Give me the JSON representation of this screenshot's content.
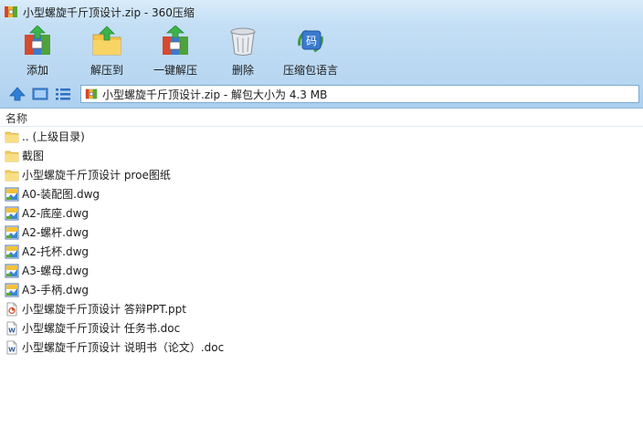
{
  "window": {
    "title": "小型螺旋千斤顶设计.zip - 360压缩"
  },
  "toolbar": {
    "items": [
      {
        "label": "添加",
        "icon": "add-archive-icon"
      },
      {
        "label": "解压到",
        "icon": "extract-to-icon"
      },
      {
        "label": "一键解压",
        "icon": "one-click-extract-icon"
      },
      {
        "label": "删除",
        "icon": "trash-bin-icon"
      },
      {
        "label": "压缩包语言",
        "icon": "archive-language-icon"
      }
    ]
  },
  "address": {
    "path": "小型螺旋千斤顶设计.zip - 解包大小为 4.3 MB"
  },
  "list": {
    "column_name": "名称",
    "rows": [
      {
        "name": ".. (上级目录)",
        "type": "folder"
      },
      {
        "name": "截图",
        "type": "folder"
      },
      {
        "name": "小型螺旋千斤顶设计 proe图纸",
        "type": "folder"
      },
      {
        "name": "A0-装配图.dwg",
        "type": "dwg"
      },
      {
        "name": "A2-底座.dwg",
        "type": "dwg"
      },
      {
        "name": "A2-螺杆.dwg",
        "type": "dwg"
      },
      {
        "name": "A2-托杯.dwg",
        "type": "dwg"
      },
      {
        "name": "A3-螺母.dwg",
        "type": "dwg"
      },
      {
        "name": "A3-手柄.dwg",
        "type": "dwg"
      },
      {
        "name": "小型螺旋千斤顶设计 答辩PPT.ppt",
        "type": "ppt"
      },
      {
        "name": "小型螺旋千斤顶设计 任务书.doc",
        "type": "doc"
      },
      {
        "name": "小型螺旋千斤顶设计 说明书（论文）.doc",
        "type": "doc"
      }
    ]
  }
}
